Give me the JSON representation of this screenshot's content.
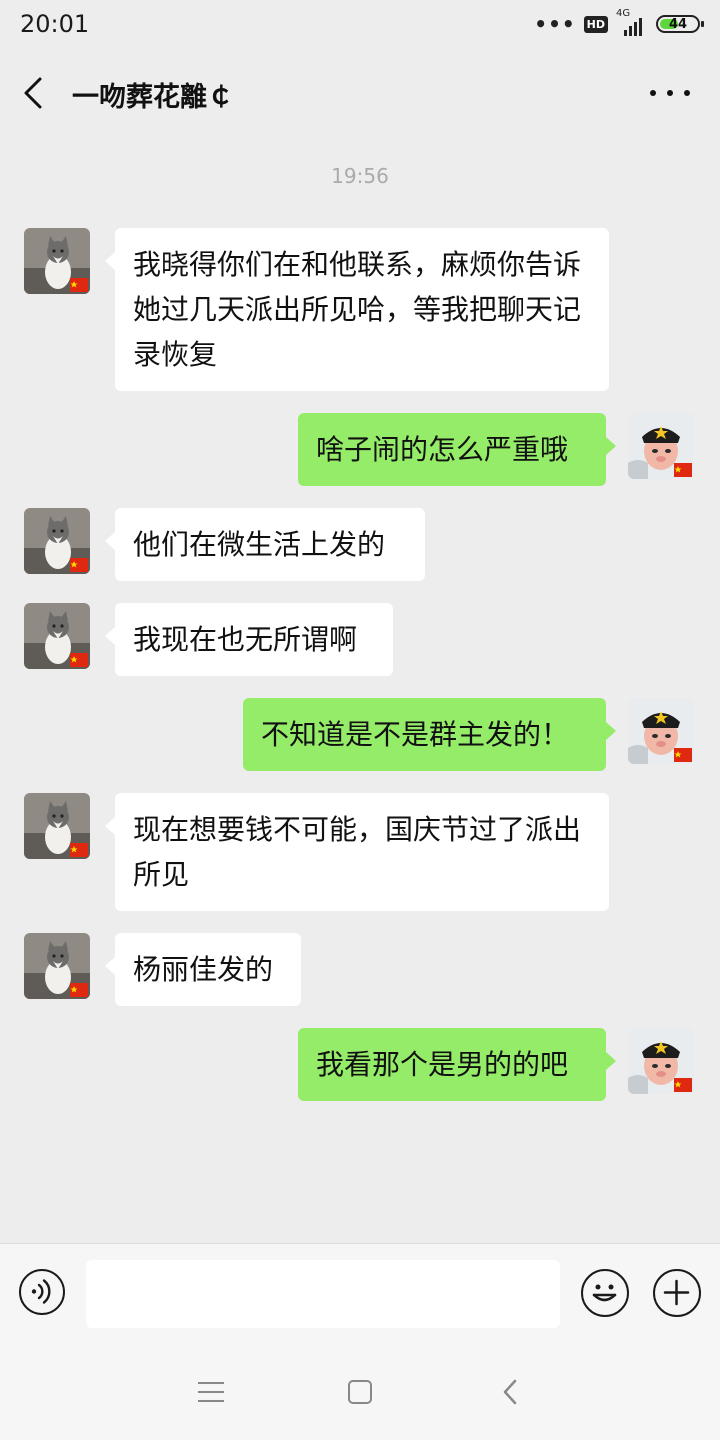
{
  "status_bar": {
    "time": "20:01",
    "hd_label": "HD",
    "network_label": "4G",
    "battery_level": "44"
  },
  "header": {
    "title": "一吻葬花離￠"
  },
  "conversation": {
    "timestamp": "19:56",
    "messages": [
      {
        "side": "left",
        "text": "我晓得你们在和他联系，麻烦你告诉她过几天派出所见哈，等我把聊天记录恢复"
      },
      {
        "side": "right",
        "text": "啥子闹的怎么严重哦"
      },
      {
        "side": "left",
        "text": "他们在微生活上发的"
      },
      {
        "side": "left",
        "text": "我现在也无所谓啊"
      },
      {
        "side": "right",
        "text": "不知道是不是群主发的！"
      },
      {
        "side": "left",
        "text": "现在想要钱不可能，国庆节过了派出所见"
      },
      {
        "side": "left",
        "text": "杨丽佳发的"
      },
      {
        "side": "right",
        "text": "我看那个是男的的吧"
      }
    ]
  },
  "input_bar": {
    "value": "",
    "voice_icon": "voice-icon",
    "emoji_icon": "emoji-icon",
    "plus_icon": "plus-icon"
  },
  "colors": {
    "sent_bubble": "#95ec69",
    "received_bubble": "#ffffff",
    "background": "#ededed"
  }
}
